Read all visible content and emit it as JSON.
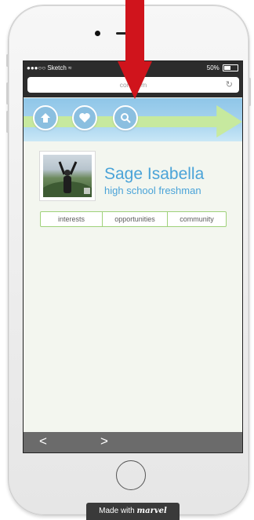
{
  "statusbar": {
    "carrier": "●●●○○ Sketch",
    "wifi_icon": "wifi-icon",
    "battery_percent": "50%"
  },
  "browser": {
    "url": "con                 .com",
    "reload_icon": "reload-icon"
  },
  "nav": {
    "buttons": [
      "home-icon",
      "heart-icon",
      "search-icon"
    ]
  },
  "profile": {
    "name": "Sage Isabella",
    "subtitle": "high school freshman"
  },
  "tabs": [
    "interests",
    "opportunities",
    "community"
  ],
  "bottombar": {
    "back": "<",
    "forward": ">"
  },
  "badge": {
    "prefix": "Made with",
    "brand": "marvel"
  },
  "colors": {
    "accent_blue": "#4aa3d8",
    "tab_border_green": "#9fd17a",
    "arrow_red": "#d0141c"
  }
}
